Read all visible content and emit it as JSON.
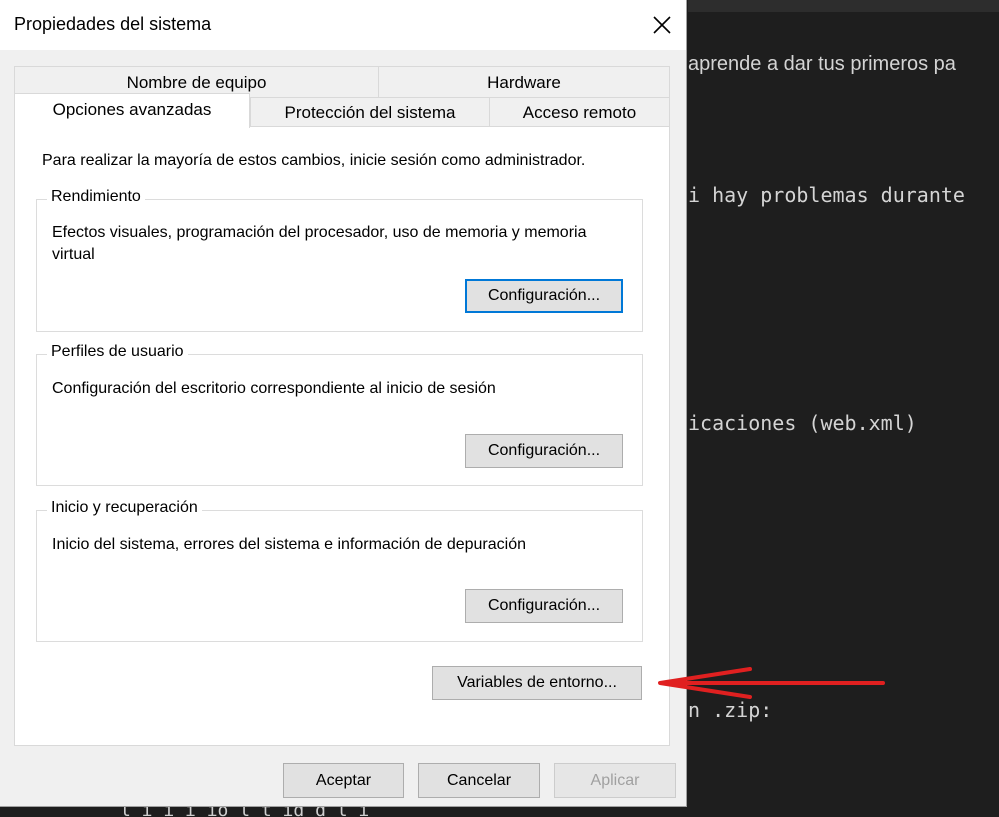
{
  "background_editor": {
    "lines": [
      {
        "text": "aprende a dar tus primeros pa",
        "style": "sans"
      },
      {
        "text": "i hay problemas durante",
        "style": "mono"
      },
      {
        "text": "icaciones (web.xml)",
        "style": "mono"
      },
      {
        "text": "n .zip:",
        "style": "mono"
      }
    ],
    "bottom_text": "l    i  i i  ió l     t  id  d l  i"
  },
  "dialog": {
    "title": "Propiedades del sistema",
    "tabs_row1": [
      "Nombre de equipo",
      "Hardware"
    ],
    "tabs_row2": [
      "Opciones avanzadas",
      "Protección del sistema",
      "Acceso remoto"
    ],
    "active_tab": "Opciones avanzadas",
    "notice": "Para realizar la mayoría de estos cambios, inicie sesión como administrador.",
    "groups": {
      "performance": {
        "legend": "Rendimiento",
        "description": "Efectos visuales, programación del procesador, uso de memoria y memoria virtual",
        "button": "Configuración..."
      },
      "profiles": {
        "legend": "Perfiles de usuario",
        "description": "Configuración del escritorio correspondiente al inicio de sesión",
        "button": "Configuración..."
      },
      "startup": {
        "legend": "Inicio y recuperación",
        "description": "Inicio del sistema, errores del sistema e información de depuración",
        "button": "Configuración..."
      }
    },
    "env_button": "Variables de entorno...",
    "footer": {
      "ok": "Aceptar",
      "cancel": "Cancelar",
      "apply": "Aplicar"
    }
  },
  "colors": {
    "annotation_arrow": "#e02020",
    "focus_border": "#0078d7"
  }
}
